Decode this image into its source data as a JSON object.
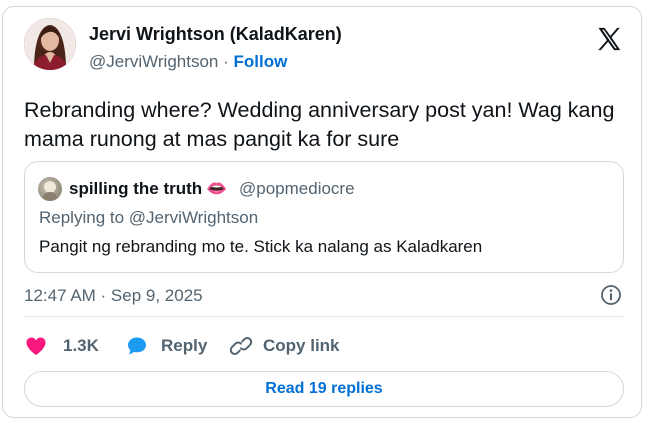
{
  "author": {
    "name": "Jervi Wrightson (KaladKaren)",
    "handle": "@JerviWrightson",
    "separator": "·",
    "follow_label": "Follow"
  },
  "tweet": {
    "text": "Rebranding where? Wedding anniversary post yan! Wag kang mama runong at mas pangit ka for sure",
    "timestamp": "12:47 AM · Sep 9, 2025"
  },
  "quoted": {
    "name": "spilling the truth",
    "emoji": "👄",
    "handle": "@popmediocre",
    "replying_prefix": "Replying to",
    "replying_handle": "@JerviWrightson",
    "text": "Pangit ng rebranding mo te. Stick ka nalang as Kaladkaren"
  },
  "actions": {
    "like_count": "1.3K",
    "reply_label": "Reply",
    "copy_label": "Copy link"
  },
  "read_replies_label": "Read 19 replies",
  "icons": {
    "brand": "x-logo-icon",
    "info": "info-icon",
    "like": "heart-icon",
    "reply": "speech-bubble-icon",
    "copy": "link-icon"
  },
  "colors": {
    "accent": "#006fd6",
    "like": "#f91880",
    "reply": "#1d9bf0",
    "muted": "#536471",
    "text": "#0f1419",
    "border": "#cfd9de"
  }
}
